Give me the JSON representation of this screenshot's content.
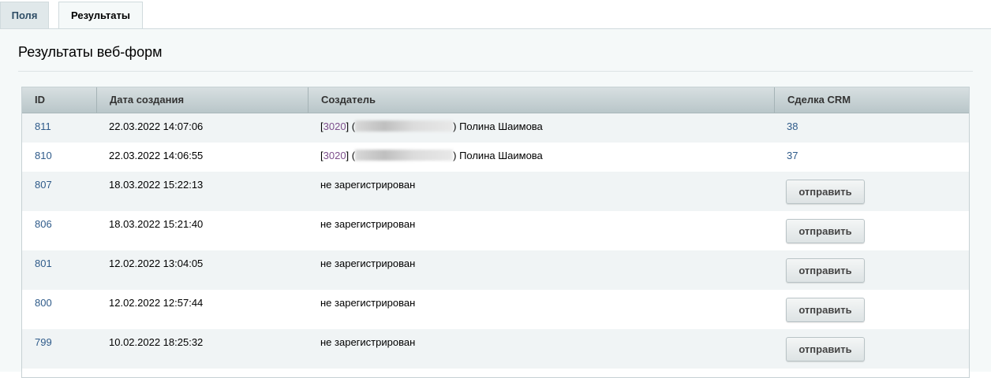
{
  "tabs": {
    "fields": "Поля",
    "results": "Результаты"
  },
  "page_title": "Результаты веб-форм",
  "columns": {
    "id": "ID",
    "date": "Дата создания",
    "creator": "Создатель",
    "crm": "Сделка CRM"
  },
  "rows": [
    {
      "id": "811",
      "date": "22.03.2022 14:07:06",
      "creator_id": "3020",
      "creator_name": "Полина Шаимова",
      "crm": "38",
      "crm_button": ""
    },
    {
      "id": "810",
      "date": "22.03.2022 14:06:55",
      "creator_id": "3020",
      "creator_name": "Полина Шаимова",
      "crm": "37",
      "crm_button": ""
    },
    {
      "id": "807",
      "date": "18.03.2022 15:22:13",
      "creator_text": "не зарегистрирован",
      "crm_button": "отправить"
    },
    {
      "id": "806",
      "date": "18.03.2022 15:21:40",
      "creator_text": "не зарегистрирован",
      "crm_button": "отправить"
    },
    {
      "id": "801",
      "date": "12.02.2022 13:04:05",
      "creator_text": "не зарегистрирован",
      "crm_button": "отправить"
    },
    {
      "id": "800",
      "date": "12.02.2022 12:57:44",
      "creator_text": "не зарегистрирован",
      "crm_button": "отправить"
    },
    {
      "id": "799",
      "date": "10.02.2022 18:25:32",
      "creator_text": "не зарегистрирован",
      "crm_button": "отправить"
    }
  ]
}
